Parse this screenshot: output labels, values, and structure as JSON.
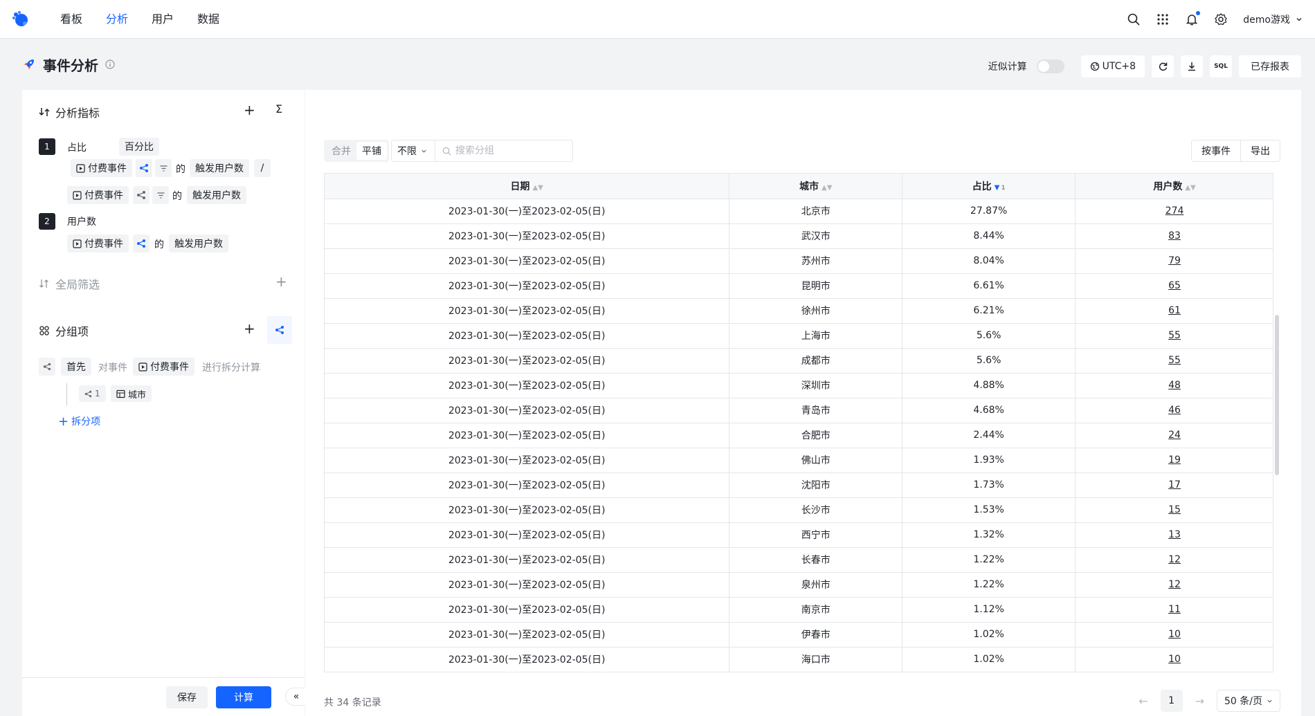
{
  "nav": {
    "items": [
      "看板",
      "分析",
      "用户",
      "数据"
    ],
    "active_index": 1,
    "user_name": "demo游戏"
  },
  "page": {
    "title": "事件分析",
    "approx_label": "近似计算",
    "approx_on": false,
    "timezone": "UTC+8",
    "sql_label": "SQL",
    "saved_reports": "已存报表"
  },
  "metrics": {
    "title": "分析指标",
    "items": [
      {
        "num": "1",
        "name": "占比",
        "format": "百分比",
        "parts": [
          {
            "event": "付费事件",
            "of": "的",
            "measure": "触发用户数",
            "op": "/"
          },
          {
            "event": "付费事件",
            "of": "的",
            "measure": "触发用户数"
          }
        ]
      },
      {
        "num": "2",
        "name": "用户数",
        "parts": [
          {
            "event": "付费事件",
            "of": "的",
            "measure": "触发用户数"
          }
        ]
      }
    ]
  },
  "global_filter": {
    "title": "全局筛选"
  },
  "grouping": {
    "title": "分组项",
    "first": "首先",
    "on_event_label": "对事件",
    "event": "付费事件",
    "action_label": "进行拆分计算",
    "sub_index": "1",
    "sub_field": "城市",
    "add_split": "拆分项"
  },
  "footer": {
    "save": "保存",
    "calc": "计算"
  },
  "toolbar": {
    "seg_merge": "合并",
    "seg_tile": "平铺",
    "limit_value": "不限",
    "search_placeholder": "搜索分组",
    "by_event": "按事件",
    "export": "导出"
  },
  "table": {
    "headers": [
      "日期",
      "城市",
      "占比",
      "用户数"
    ],
    "sort_index_label": "1",
    "rows": [
      [
        "2023-01-30(一)至2023-02-05(日)",
        "北京市",
        "27.87%",
        "274"
      ],
      [
        "2023-01-30(一)至2023-02-05(日)",
        "武汉市",
        "8.44%",
        "83"
      ],
      [
        "2023-01-30(一)至2023-02-05(日)",
        "苏州市",
        "8.04%",
        "79"
      ],
      [
        "2023-01-30(一)至2023-02-05(日)",
        "昆明市",
        "6.61%",
        "65"
      ],
      [
        "2023-01-30(一)至2023-02-05(日)",
        "徐州市",
        "6.21%",
        "61"
      ],
      [
        "2023-01-30(一)至2023-02-05(日)",
        "上海市",
        "5.6%",
        "55"
      ],
      [
        "2023-01-30(一)至2023-02-05(日)",
        "成都市",
        "5.6%",
        "55"
      ],
      [
        "2023-01-30(一)至2023-02-05(日)",
        "深圳市",
        "4.88%",
        "48"
      ],
      [
        "2023-01-30(一)至2023-02-05(日)",
        "青岛市",
        "4.68%",
        "46"
      ],
      [
        "2023-01-30(一)至2023-02-05(日)",
        "合肥市",
        "2.44%",
        "24"
      ],
      [
        "2023-01-30(一)至2023-02-05(日)",
        "佛山市",
        "1.93%",
        "19"
      ],
      [
        "2023-01-30(一)至2023-02-05(日)",
        "沈阳市",
        "1.73%",
        "17"
      ],
      [
        "2023-01-30(一)至2023-02-05(日)",
        "长沙市",
        "1.53%",
        "15"
      ],
      [
        "2023-01-30(一)至2023-02-05(日)",
        "西宁市",
        "1.32%",
        "13"
      ],
      [
        "2023-01-30(一)至2023-02-05(日)",
        "长春市",
        "1.22%",
        "12"
      ],
      [
        "2023-01-30(一)至2023-02-05(日)",
        "泉州市",
        "1.22%",
        "12"
      ],
      [
        "2023-01-30(一)至2023-02-05(日)",
        "南京市",
        "1.12%",
        "11"
      ],
      [
        "2023-01-30(一)至2023-02-05(日)",
        "伊春市",
        "1.02%",
        "10"
      ],
      [
        "2023-01-30(一)至2023-02-05(日)",
        "海口市",
        "1.02%",
        "10"
      ]
    ]
  },
  "pagination": {
    "total": "共 34 条记录",
    "current": "1",
    "page_size": "50 条/页"
  },
  "colors": {
    "accent": "#1664ff",
    "text": "#1f2329",
    "muted": "#8f959e"
  }
}
